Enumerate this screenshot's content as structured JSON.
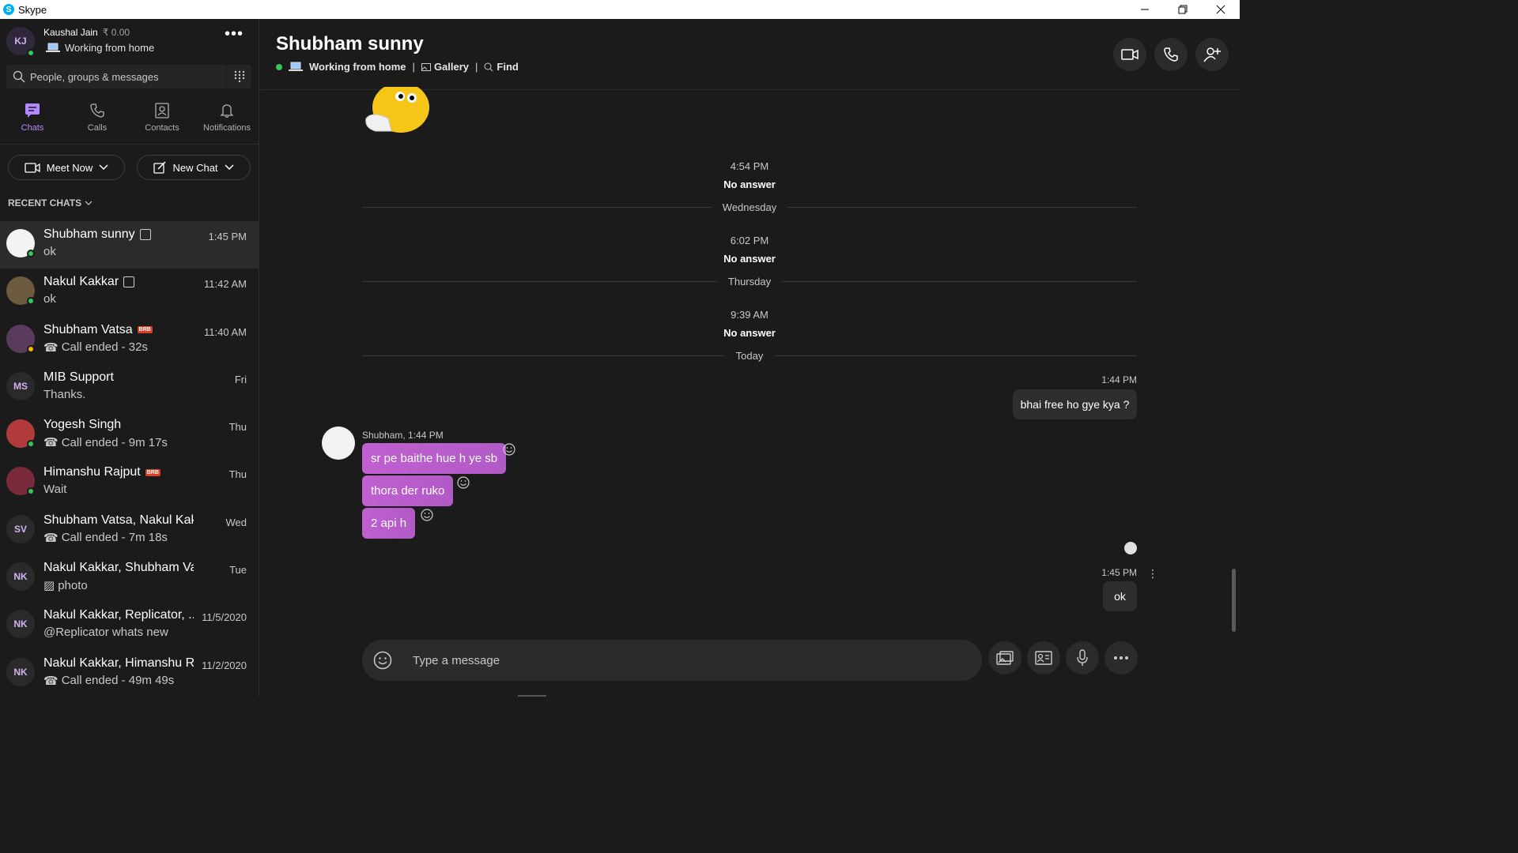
{
  "window": {
    "title": "Skype"
  },
  "profile": {
    "initials": "KJ",
    "name": "Kaushal Jain",
    "credit": "₹ 0.00",
    "status": "Working from home"
  },
  "search": {
    "placeholder": "People, groups & messages"
  },
  "nav": {
    "tabs": [
      {
        "label": "Chats"
      },
      {
        "label": "Calls"
      },
      {
        "label": "Contacts"
      },
      {
        "label": "Notifications"
      }
    ]
  },
  "actions": {
    "meet_now": "Meet Now",
    "new_chat": "New Chat"
  },
  "recent": {
    "label": "RECENT CHATS"
  },
  "chats": [
    {
      "name": "Shubham sunny",
      "preview": "ok",
      "time": "1:45 PM"
    },
    {
      "name": "Nakul Kakkar",
      "preview": "ok",
      "time": "11:42 AM"
    },
    {
      "name": "Shubham Vatsa",
      "preview": "Call ended - 32s",
      "time": "11:40 AM",
      "badge": "BRB"
    },
    {
      "name": "MIB Support",
      "preview": "Thanks.",
      "time": "Fri",
      "initials": "MS"
    },
    {
      "name": "Yogesh Singh",
      "preview": "Call ended - 9m 17s",
      "time": "Thu"
    },
    {
      "name": "Himanshu Rajput",
      "preview": "Wait",
      "time": "Thu",
      "badge": "BRB"
    },
    {
      "name": "Shubham Vatsa, Nakul Kakkar",
      "preview": "Call ended - 7m 18s",
      "time": "Wed",
      "initials": "SV"
    },
    {
      "name": "Nakul Kakkar, Shubham Vatsa",
      "preview": "photo",
      "time": "Tue",
      "initials": "NK"
    },
    {
      "name": "Nakul Kakkar, Replicator, ...",
      "preview": "@Replicator whats new",
      "time": "11/5/2020",
      "initials": "NK"
    },
    {
      "name": "Nakul Kakkar, Himanshu R...",
      "preview": "Call ended - 49m 49s",
      "time": "11/2/2020",
      "initials": "NK"
    }
  ],
  "conversation": {
    "title": "Shubham sunny",
    "status": "Working from home",
    "gallery": "Gallery",
    "find": "Find",
    "events": [
      {
        "time": "4:54 PM",
        "text": "No answer"
      },
      {
        "day": "Wednesday"
      },
      {
        "time": "6:02 PM",
        "text": "No answer"
      },
      {
        "day": "Thursday"
      },
      {
        "time": "9:39 AM",
        "text": "No answer"
      },
      {
        "day": "Today"
      }
    ],
    "out1": {
      "time": "1:44 PM",
      "text": "bhai free ho gye kya ?"
    },
    "incoming": {
      "sender": "Shubham, 1:44 PM",
      "messages": [
        "sr pe baithe hue h ye sb",
        "thora der ruko",
        "2 api h"
      ]
    },
    "out2": {
      "time": "1:45 PM",
      "text": "ok"
    },
    "composer_placeholder": "Type a message"
  },
  "colors": {
    "accent": "#b388ff",
    "bubble_in": "#c05fd0",
    "online": "#34c759"
  }
}
